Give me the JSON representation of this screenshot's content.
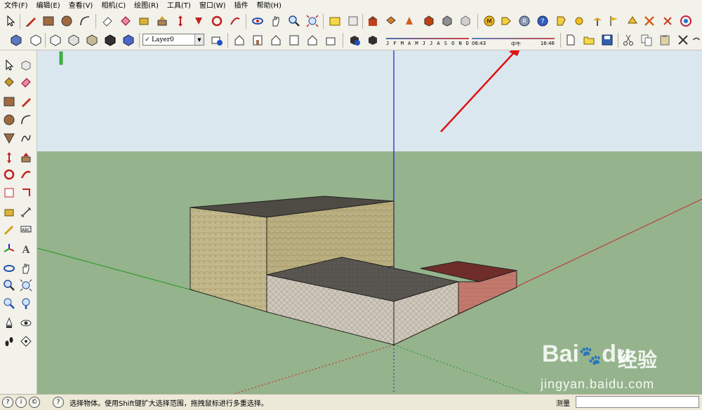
{
  "menu": [
    "文件(F)",
    "编辑(E)",
    "查看(V)",
    "相机(C)",
    "绘图(R)",
    "工具(T)",
    "窗口(W)",
    "插件",
    "帮助(H)"
  ],
  "layer": {
    "check": "✓",
    "name": "Layer0"
  },
  "shadow": {
    "months": [
      "J",
      "F",
      "M",
      "A",
      "M",
      "J",
      "J",
      "A",
      "S",
      "O",
      "N",
      "D"
    ],
    "time_start": "06:43",
    "time_mid": "中午",
    "time_end": "16:46"
  },
  "status": {
    "message": "选择物体。使用Shift键扩大选择范围，拖拽鼠标进行多重选择。",
    "measure_label": "测量",
    "measure_value": ""
  },
  "watermark": {
    "logo": "Bai",
    "logo2": "du",
    "cn": "经验",
    "url": "jingyan.baidu.com"
  },
  "colors": {
    "sky": "#dbe7ef",
    "ground": "#95b38c",
    "annotation_arrow": "#e01010",
    "axis_red": "#cc2020",
    "axis_green": "#1a9a1a",
    "axis_blue": "#1a1ad0"
  },
  "icons": {
    "toolbar1": [
      "select-icon",
      "pencil-icon",
      "rectangle-icon",
      "circle-icon",
      "arc-icon",
      "eraser-icon",
      "paint-bucket-icon",
      "tape-measure-icon",
      "push-pull-icon",
      "move-icon",
      "rotate-icon",
      "follow-me-icon",
      "offset-icon",
      "orbit-icon",
      "pan-icon",
      "zoom-icon",
      "zoom-extents-icon",
      "previous-view-icon",
      "next-view-icon",
      "3d-warehouse-icon",
      "components-icon",
      "google-earth-icon",
      "get-models-icon",
      "share-model-icon",
      "plugin-m-icon",
      "plugin-tag-icon",
      "plugin-r-icon",
      "help-icon",
      "plugin-yellow-icon",
      "sphere-icon",
      "tools-icon",
      "flag-icon",
      "pinwheel-icon"
    ],
    "toolbar2": [
      "iso-view-icon",
      "top-view-icon",
      "front-view-icon",
      "right-view-icon",
      "back-view-icon",
      "left-view-icon",
      "xray-icon",
      "wireframe-icon",
      "hidden-line-icon",
      "shaded-icon",
      "shaded-textures-icon",
      "monochrome-icon",
      "layer-manager-icon",
      "house-1-icon",
      "house-2-icon",
      "house-3-icon",
      "house-4-icon",
      "house-5-icon",
      "section-plane-icon",
      "display-section-icon",
      "shadow-settings-icon",
      "new-icon",
      "open-icon",
      "save-icon",
      "cut-icon",
      "copy-icon",
      "paste-icon",
      "delete-icon",
      "undo-icon"
    ]
  }
}
